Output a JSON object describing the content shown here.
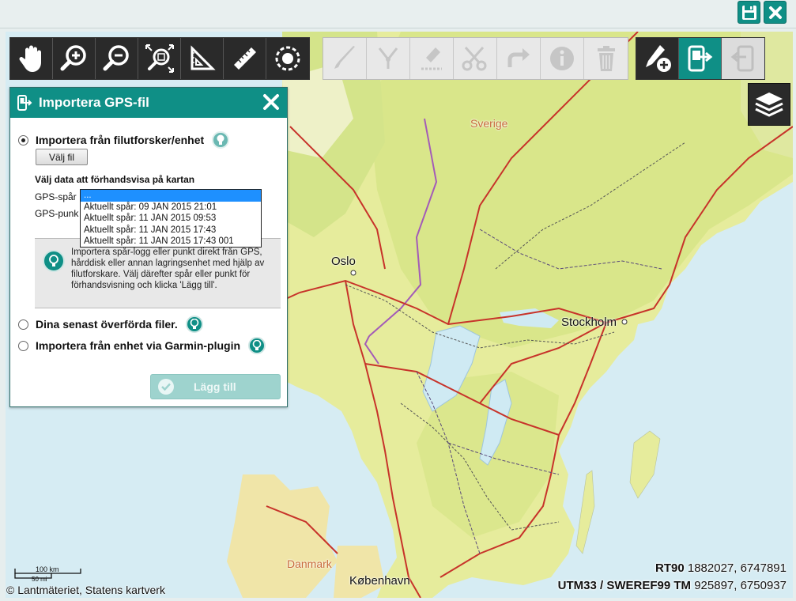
{
  "header": {
    "save_icon": "floppy-disk-icon",
    "close_icon": "close-icon",
    "accent_color": "#0f8f86"
  },
  "map": {
    "places": {
      "sweden": "Sverige",
      "oslo": "Oslo",
      "stockholm": "Stockholm",
      "denmark": "Danmark",
      "copenhagen": "København"
    },
    "scale": {
      "km": "100 km",
      "mi": "50 mi"
    },
    "copyright": "© Lantmäteriet, Statens kartverk",
    "coords": {
      "rt90_label": "RT90",
      "rt90_value": "1882027, 6747891",
      "utm_label": "UTM33 / SWEREF99 TM",
      "utm_value": "925897, 6750937"
    }
  },
  "toolbar": {
    "navigation_tools": [
      "pan-hand-icon",
      "zoom-in-icon",
      "zoom-out-icon",
      "zoom-extent-icon",
      "angle-measure-icon",
      "ruler-icon",
      "locate-position-icon"
    ],
    "edit_tools": [
      "draw-icon",
      "edit-vertices-icon",
      "edit-point-icon",
      "cut-icon",
      "redo-icon",
      "info-icon",
      "delete-icon"
    ],
    "file_tools": [
      "add-object-icon",
      "import-gps-icon",
      "export-gps-icon"
    ],
    "layers_icon": "layers-icon"
  },
  "panel": {
    "title": "Importera GPS-fil",
    "option_file": "Importera från filutforsker/enhet",
    "choose_file_button": "Välj fil",
    "preview_label": "Välj data att förhandsvisa på kartan",
    "gps_track_label": "GPS-spår",
    "gps_points_label": "GPS-punk",
    "track_options": [
      "...",
      "Aktuellt spår: 09 JAN 2015 21:01",
      "Aktuellt spår: 11 JAN 2015 09:53",
      "Aktuellt spår: 11 JAN 2015 17:43",
      "Aktuellt spår: 11 JAN 2015 17:43 001"
    ],
    "info_text": "Importera spår-logg eller punkt direkt från GPS, hårddisk eller annan lagringsenhet med hjälp av filutforskare. Välj därefter spår eller punkt för förhandsvisning och klicka 'Lägg till'.",
    "option_recent": "Dina senast överförda filer.",
    "option_garmin": "Importera från enhet via Garmin-plugin",
    "add_button": "Lägg till"
  }
}
